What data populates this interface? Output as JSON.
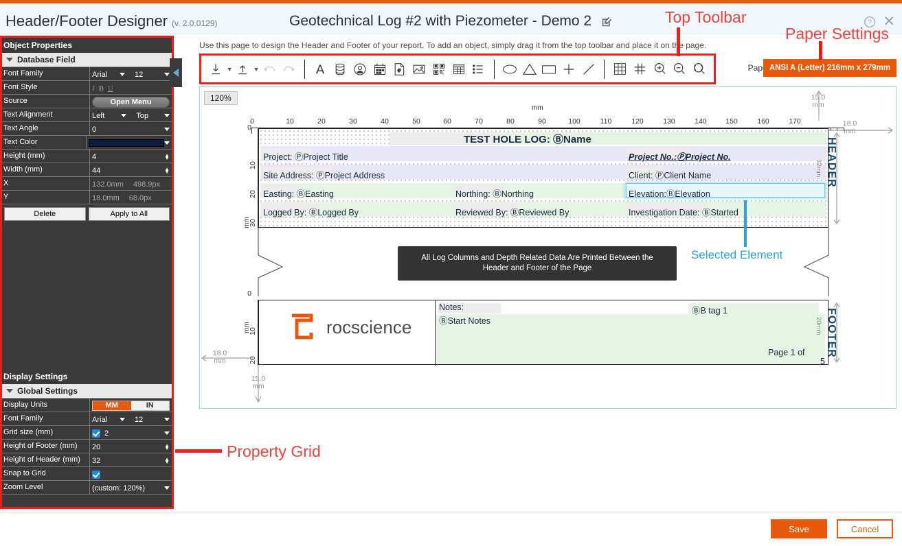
{
  "window": {
    "app_title": "Header/Footer Designer",
    "version": "(v. 2.0.0129)",
    "document_title": "Geotechnical Log #2 with Piezometer - Demo 2",
    "help_icon": "question-circle-icon",
    "close_icon": "close-icon",
    "edit_icon": "edit-pencil-icon"
  },
  "hint": "Use this page to design the Header and Footer of your report. To add an object, simply drag it from the top toolbar and place it on the page.",
  "paper": {
    "label": "Paper:",
    "value": "ANSI A (Letter) 216mm x 279mm"
  },
  "toolbar": {
    "items": [
      {
        "name": "import-icon",
        "glyph": "download",
        "caret": true
      },
      {
        "name": "export-icon",
        "glyph": "upload",
        "caret": true
      },
      {
        "name": "undo-icon",
        "glyph": "undo"
      },
      {
        "name": "redo-icon",
        "glyph": "redo"
      },
      {
        "name": "text-icon",
        "glyph": "A"
      },
      {
        "name": "database-field-icon",
        "glyph": "db"
      },
      {
        "name": "user-field-icon",
        "glyph": "user"
      },
      {
        "name": "date-field-icon",
        "glyph": "calendar"
      },
      {
        "name": "page-number-icon",
        "glyph": "hashpage"
      },
      {
        "name": "image-icon",
        "glyph": "picture"
      },
      {
        "name": "qr-code-icon",
        "glyph": "qr"
      },
      {
        "name": "table-icon",
        "glyph": "table"
      },
      {
        "name": "list-icon",
        "glyph": "list"
      },
      {
        "name": "ellipse-icon",
        "glyph": "ellipse"
      },
      {
        "name": "triangle-icon",
        "glyph": "triangle"
      },
      {
        "name": "rectangle-icon",
        "glyph": "rect"
      },
      {
        "name": "cross-icon",
        "glyph": "plus"
      },
      {
        "name": "line-icon",
        "glyph": "line"
      },
      {
        "name": "grid-icon",
        "glyph": "grid"
      },
      {
        "name": "snap-icon",
        "glyph": "snap"
      },
      {
        "name": "zoom-in-icon",
        "glyph": "zoomin"
      },
      {
        "name": "zoom-out-icon",
        "glyph": "zoomout"
      },
      {
        "name": "zoom-fit-icon",
        "glyph": "zoomfit"
      }
    ]
  },
  "object_properties": {
    "section_title": "Object Properties",
    "group_title": "Database Field",
    "rows": [
      {
        "label": "Font Family",
        "value": "Arial",
        "value2": "12",
        "type": "dual-select"
      },
      {
        "label": "Font Style",
        "value": "",
        "type": "font-style"
      },
      {
        "label": "Source",
        "value": "Open Menu",
        "type": "button"
      },
      {
        "label": "Text Alignment",
        "value": "Left",
        "value2": "Top",
        "type": "dual-select"
      },
      {
        "label": "Text Angle",
        "value": "0",
        "type": "select"
      },
      {
        "label": "Text Color",
        "value": "#0d1b3e",
        "type": "color"
      },
      {
        "label": "Height (mm)",
        "value": "4",
        "type": "spinner"
      },
      {
        "label": "Width (mm)",
        "value": "44",
        "type": "spinner"
      },
      {
        "label": "X",
        "value": "132.0mm",
        "value2": "498.9px",
        "type": "readonly"
      },
      {
        "label": "Y",
        "value": "18.0mm",
        "value2": "68.0px",
        "type": "readonly"
      }
    ],
    "delete_label": "Delete",
    "apply_all_label": "Apply to All"
  },
  "display_settings": {
    "section_title": "Display Settings",
    "group_title": "Global Settings",
    "rows": [
      {
        "label": "Display Units",
        "value": "MM",
        "value2": "IN",
        "type": "units"
      },
      {
        "label": "Font Family",
        "value": "Arial",
        "value2": "12",
        "type": "dual-select"
      },
      {
        "label": "Grid size (mm)",
        "value": "2",
        "type": "check-select"
      },
      {
        "label": "Height of Footer (mm)",
        "value": "20",
        "type": "spinner"
      },
      {
        "label": "Height of Header (mm)",
        "value": "32",
        "type": "spinner"
      },
      {
        "label": "Snap to Grid",
        "value": "",
        "type": "checkbox"
      },
      {
        "label": "Zoom Level",
        "value": "(custom: 120%)",
        "type": "select"
      }
    ]
  },
  "canvas": {
    "zoom_badge": "120%",
    "ruler_unit": "mm",
    "h_ticks": [
      0,
      10,
      20,
      30,
      40,
      50,
      60,
      70,
      80,
      90,
      100,
      110,
      120,
      130,
      140,
      150,
      160,
      170
    ],
    "v_ticks_header": [
      0,
      10,
      20,
      30
    ],
    "v_ticks_footer": [
      0,
      10,
      20
    ],
    "header_fields": [
      {
        "text": "TEST HOLE LOG: ⒷName",
        "bold": true
      },
      {
        "text": "Project:  ⓅProject Title"
      },
      {
        "text": "Site Address:  ⓅProject Address"
      },
      {
        "text": "Easting:  ⒷEasting"
      },
      {
        "text": "Logged By:  ⒷLogged By"
      },
      {
        "text": "Northing: ⒷNorthing"
      },
      {
        "text": "Reviewed By: ⒷReviewed By"
      },
      {
        "text": "Project No.:ⓅProject No."
      },
      {
        "text": "Client: ⓅClient Name"
      },
      {
        "text": "Elevation:ⒷElevation"
      },
      {
        "text": "Investigation Date:  ⒷStarted"
      }
    ],
    "banner_line1": "All Log Columns and Depth Related Data Are Printed Between the",
    "banner_line2": "Header and Footer of the Page",
    "footer_fields": [
      {
        "text": "Notes:"
      },
      {
        "text": "ⒷStart Notes"
      },
      {
        "text": "ⒷB tag 1"
      },
      {
        "text": "Page 1 of"
      },
      {
        "text": "5"
      }
    ],
    "logo_text": "rocscience",
    "dims": {
      "top_margin": "15.0\nmm",
      "right_margin": "18.0\nmm",
      "left_margin": "18.0\nmm",
      "bottom_margin": "15.0\nmm",
      "header_height": "32mm",
      "footer_height": "20mm",
      "header_word": "HEADER",
      "footer_word": "FOOTER"
    }
  },
  "annotations": [
    {
      "name": "annotation-top-toolbar",
      "text": "Top Toolbar",
      "color": "#f0423c"
    },
    {
      "name": "annotation-paper-settings",
      "text": "Paper Settings",
      "color": "#f0423c"
    },
    {
      "name": "annotation-property-grid",
      "text": "Property Grid",
      "color": "#f0423c"
    },
    {
      "name": "annotation-selected-element",
      "text": "Selected Element",
      "color": "#29a3e3"
    }
  ],
  "footer_buttons": {
    "save": "Save",
    "cancel": "Cancel"
  }
}
